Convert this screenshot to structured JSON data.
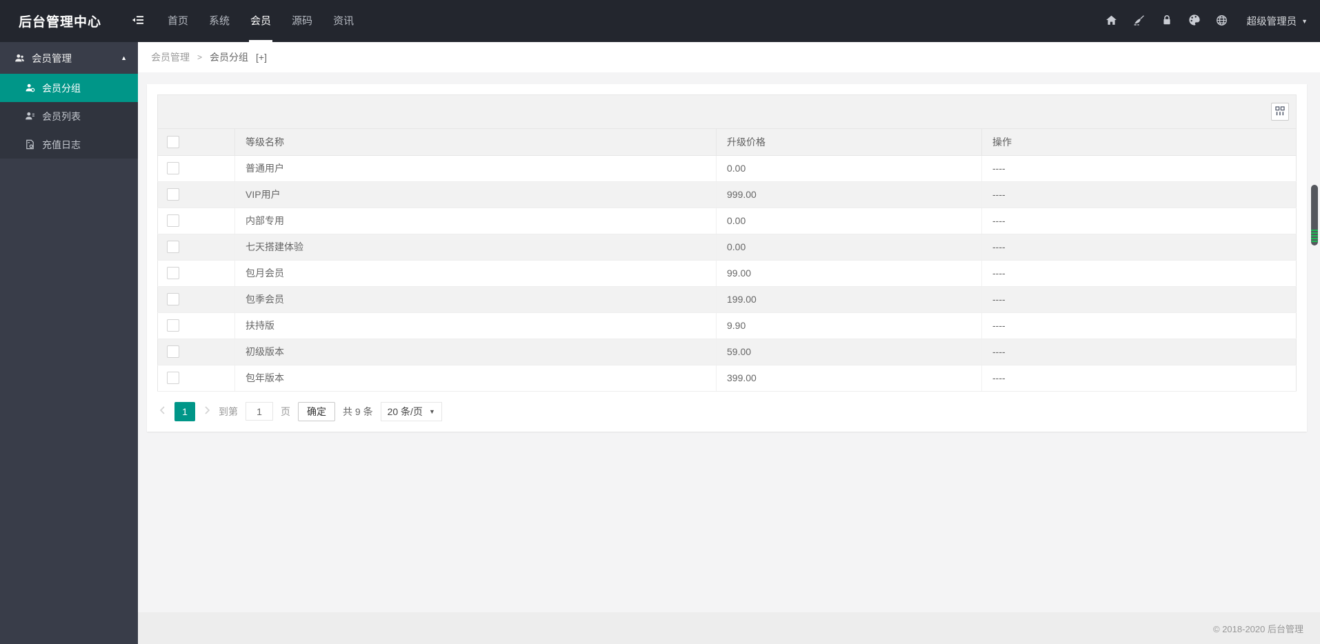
{
  "header": {
    "logo": "后台管理中心",
    "nav": [
      {
        "label": "首页"
      },
      {
        "label": "系统"
      },
      {
        "label": "会员"
      },
      {
        "label": "源码"
      },
      {
        "label": "资讯"
      }
    ],
    "active_nav": "会员",
    "username": "超级管理员"
  },
  "sidebar": {
    "group": {
      "label": "会员管理"
    },
    "items": [
      {
        "label": "会员分组",
        "active": true
      },
      {
        "label": "会员列表",
        "active": false
      },
      {
        "label": "充值日志",
        "active": false
      }
    ]
  },
  "breadcrumb": {
    "parent": "会员管理",
    "separator": ">",
    "current": "会员分组",
    "suffix": "[+]"
  },
  "table": {
    "columns": {
      "name": "等级名称",
      "price": "升级价格",
      "action": "操作"
    },
    "rows": [
      {
        "name": "普通用户",
        "price": "0.00",
        "action": "----"
      },
      {
        "name": "VIP用户",
        "price": "999.00",
        "action": "----"
      },
      {
        "name": "内部专用",
        "price": "0.00",
        "action": "----"
      },
      {
        "name": "七天搭建体验",
        "price": "0.00",
        "action": "----"
      },
      {
        "name": "包月会员",
        "price": "99.00",
        "action": "----"
      },
      {
        "name": "包季会员",
        "price": "199.00",
        "action": "----"
      },
      {
        "name": "扶持版",
        "price": "9.90",
        "action": "----"
      },
      {
        "name": "初级版本",
        "price": "59.00",
        "action": "----"
      },
      {
        "name": "包年版本",
        "price": "399.00",
        "action": "----"
      }
    ]
  },
  "pagination": {
    "current_page": "1",
    "goto_label": "到第",
    "page_input_value": "1",
    "page_unit": "页",
    "confirm_label": "确定",
    "total_label": "共 9 条",
    "per_page_label": "20 条/页"
  },
  "footer": {
    "copyright": "© 2018-2020 后台管理"
  },
  "colors": {
    "accent": "#009688",
    "header_bg": "#23262e",
    "sidebar_bg": "#393d49",
    "stripe": "#f2f2f2"
  }
}
